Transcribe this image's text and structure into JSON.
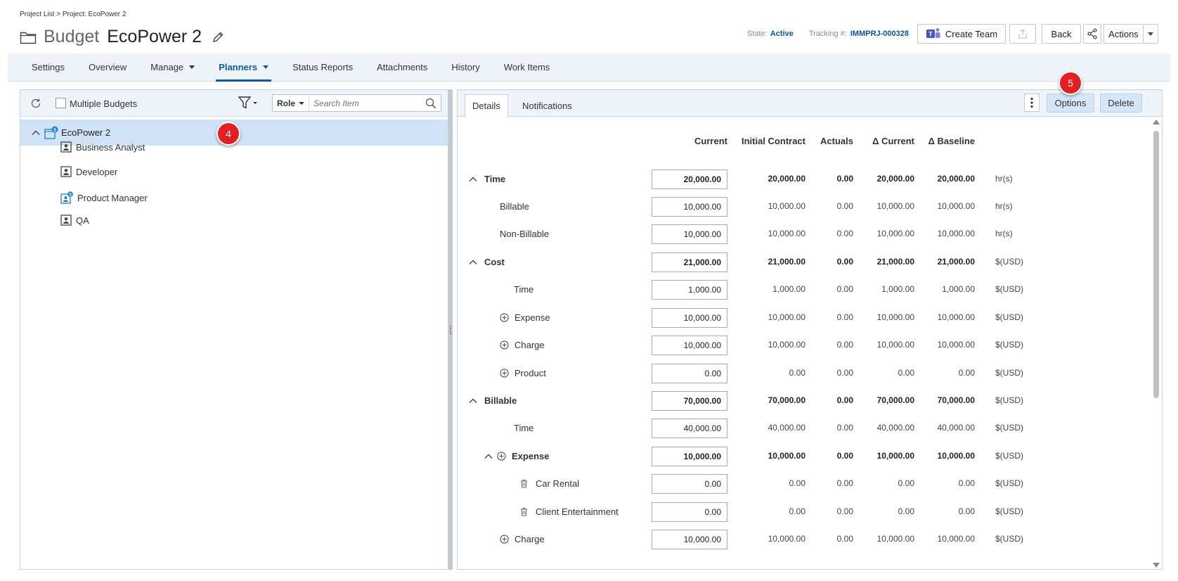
{
  "breadcrumb": "Project List > Project: EcoPower 2",
  "title": {
    "kind": "Budget",
    "name": "EcoPower 2"
  },
  "header": {
    "state_label": "State:",
    "state_value": "Active",
    "tracking_label": "Tracking #:",
    "tracking_value": "IMMPRJ-000328",
    "create_team": "Create Team",
    "back": "Back",
    "actions": "Actions"
  },
  "tabs": [
    {
      "label": "Settings"
    },
    {
      "label": "Overview"
    },
    {
      "label": "Manage"
    },
    {
      "label": "Planners"
    },
    {
      "label": "Status Reports"
    },
    {
      "label": "Attachments"
    },
    {
      "label": "History"
    },
    {
      "label": "Work Items"
    }
  ],
  "left": {
    "multiple_budgets": "Multiple Budgets",
    "role_select": "Role",
    "search_placeholder": "Search Item",
    "root": "EcoPower 2",
    "items": [
      "Business Analyst",
      "Developer",
      "Product Manager",
      "QA"
    ],
    "badge": "4"
  },
  "right": {
    "tab_details": "Details",
    "tab_notifications": "Notifications",
    "options": "Options",
    "delete": "Delete",
    "badge": "5",
    "columns": [
      "Current",
      "Initial Contract",
      "Actuals",
      "Δ Current",
      "Δ Baseline"
    ],
    "rows": [
      {
        "label": "Time",
        "current": "20,000.00",
        "initial": "20,000.00",
        "actuals": "0.00",
        "dcur": "20,000.00",
        "dbase": "20,000.00",
        "unit": "hr(s)"
      },
      {
        "label": "Billable",
        "current": "10,000.00",
        "initial": "10,000.00",
        "actuals": "0.00",
        "dcur": "10,000.00",
        "dbase": "10,000.00",
        "unit": "hr(s)"
      },
      {
        "label": "Non-Billable",
        "current": "10,000.00",
        "initial": "10,000.00",
        "actuals": "0.00",
        "dcur": "10,000.00",
        "dbase": "10,000.00",
        "unit": "hr(s)"
      },
      {
        "label": "Cost",
        "current": "21,000.00",
        "initial": "21,000.00",
        "actuals": "0.00",
        "dcur": "21,000.00",
        "dbase": "21,000.00",
        "unit": "$(USD)"
      },
      {
        "label": "Time",
        "current": "1,000.00",
        "initial": "1,000.00",
        "actuals": "0.00",
        "dcur": "1,000.00",
        "dbase": "1,000.00",
        "unit": "$(USD)"
      },
      {
        "label": "Expense",
        "current": "10,000.00",
        "initial": "10,000.00",
        "actuals": "0.00",
        "dcur": "10,000.00",
        "dbase": "10,000.00",
        "unit": "$(USD)"
      },
      {
        "label": "Charge",
        "current": "10,000.00",
        "initial": "10,000.00",
        "actuals": "0.00",
        "dcur": "10,000.00",
        "dbase": "10,000.00",
        "unit": "$(USD)"
      },
      {
        "label": "Product",
        "current": "0.00",
        "initial": "0.00",
        "actuals": "0.00",
        "dcur": "0.00",
        "dbase": "0.00",
        "unit": "$(USD)"
      },
      {
        "label": "Billable",
        "current": "70,000.00",
        "initial": "70,000.00",
        "actuals": "0.00",
        "dcur": "70,000.00",
        "dbase": "70,000.00",
        "unit": "$(USD)"
      },
      {
        "label": "Time",
        "current": "40,000.00",
        "initial": "40,000.00",
        "actuals": "0.00",
        "dcur": "40,000.00",
        "dbase": "40,000.00",
        "unit": "$(USD)"
      },
      {
        "label": "Expense",
        "current": "10,000.00",
        "initial": "10,000.00",
        "actuals": "0.00",
        "dcur": "10,000.00",
        "dbase": "10,000.00",
        "unit": "$(USD)"
      },
      {
        "label": "Car Rental",
        "current": "0.00",
        "initial": "0.00",
        "actuals": "0.00",
        "dcur": "0.00",
        "dbase": "0.00",
        "unit": "$(USD)"
      },
      {
        "label": "Client Entertainment",
        "current": "0.00",
        "initial": "0.00",
        "actuals": "0.00",
        "dcur": "0.00",
        "dbase": "0.00",
        "unit": "$(USD)"
      },
      {
        "label": "Charge",
        "current": "10,000.00",
        "initial": "10,000.00",
        "actuals": "0.00",
        "dcur": "10,000.00",
        "dbase": "10,000.00",
        "unit": "$(USD)"
      }
    ]
  },
  "colors": {
    "accent": "#0f5a9e",
    "tab_bg": "#eef4fa",
    "selected_row": "#cfe2f6",
    "badge": "#e31e24",
    "button_light": "#d4e6f7"
  }
}
